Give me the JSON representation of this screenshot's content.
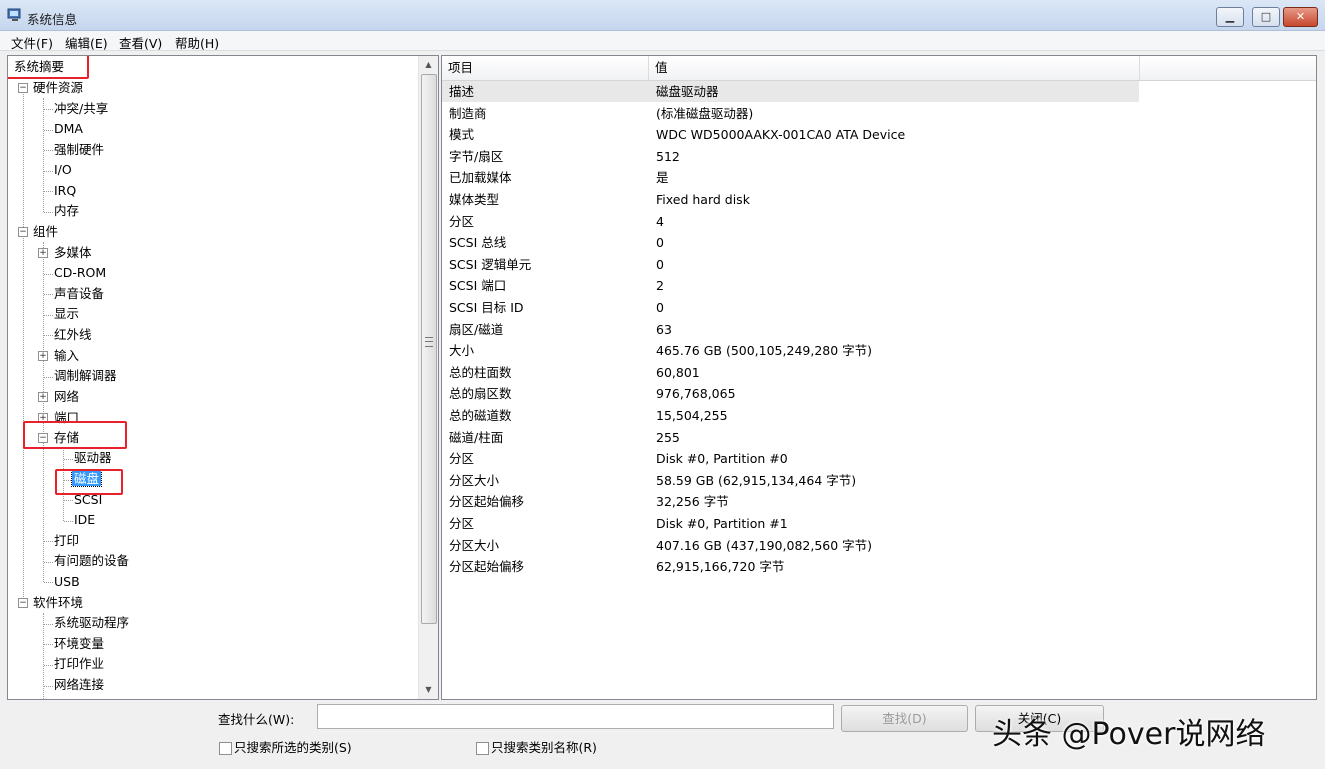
{
  "window": {
    "title": "系统信息"
  },
  "menu": [
    {
      "label": "文件(F)"
    },
    {
      "label": "编辑(E)"
    },
    {
      "label": "查看(V)"
    },
    {
      "label": "帮助(H)"
    }
  ],
  "tree": {
    "root": "系统摘要",
    "hardware": {
      "label": "硬件资源",
      "children": [
        "冲突/共享",
        "DMA",
        "强制硬件",
        "I/O",
        "IRQ",
        "内存"
      ]
    },
    "components": {
      "label": "组件",
      "children": [
        "多媒体",
        "CD-ROM",
        "声音设备",
        "显示",
        "红外线",
        "输入",
        "调制解调器",
        "网络",
        "端口",
        "存储",
        "打印",
        "有问题的设备",
        "USB"
      ]
    },
    "storage_children": [
      "驱动器",
      "磁盘",
      "SCSI",
      "IDE"
    ],
    "software": {
      "label": "软件环境",
      "children": [
        "系统驱动程序",
        "环境变量",
        "打印作业",
        "网络连接"
      ]
    },
    "selected": "磁盘"
  },
  "list": {
    "headers": [
      "项目",
      "值"
    ],
    "rows": [
      [
        "描述",
        "磁盘驱动器"
      ],
      [
        "制造商",
        "(标准磁盘驱动器)"
      ],
      [
        "模式",
        "WDC WD5000AAKX-001CA0 ATA Device"
      ],
      [
        "字节/扇区",
        "512"
      ],
      [
        "已加载媒体",
        "是"
      ],
      [
        "媒体类型",
        "Fixed hard disk"
      ],
      [
        "分区",
        "4"
      ],
      [
        "SCSI 总线",
        "0"
      ],
      [
        "SCSI 逻辑单元",
        "0"
      ],
      [
        "SCSI 端口",
        "2"
      ],
      [
        "SCSI 目标 ID",
        "0"
      ],
      [
        "扇区/磁道",
        "63"
      ],
      [
        "大小",
        "465.76 GB (500,105,249,280 字节)"
      ],
      [
        "总的柱面数",
        "60,801"
      ],
      [
        "总的扇区数",
        "976,768,065"
      ],
      [
        "总的磁道数",
        "15,504,255"
      ],
      [
        "磁道/柱面",
        "255"
      ],
      [
        "分区",
        "Disk #0, Partition #0"
      ],
      [
        "分区大小",
        "58.59 GB (62,915,134,464 字节)"
      ],
      [
        "分区起始偏移",
        "32,256 字节"
      ],
      [
        "分区",
        "Disk #0, Partition #1"
      ],
      [
        "分区大小",
        "407.16 GB (437,190,082,560 字节)"
      ],
      [
        "分区起始偏移",
        "62,915,166,720 字节"
      ]
    ]
  },
  "search": {
    "label": "查找什么(W):",
    "value": "",
    "find_button": "查找(D)",
    "close_button": "关闭(C)",
    "check_selected": "只搜索所选的类别(S)",
    "check_names": "只搜索类别名称(R)"
  },
  "watermark": "头条 @Pover说网络",
  "colors": {
    "selection": "#3399ff",
    "highlight_box": "#e8222a"
  }
}
